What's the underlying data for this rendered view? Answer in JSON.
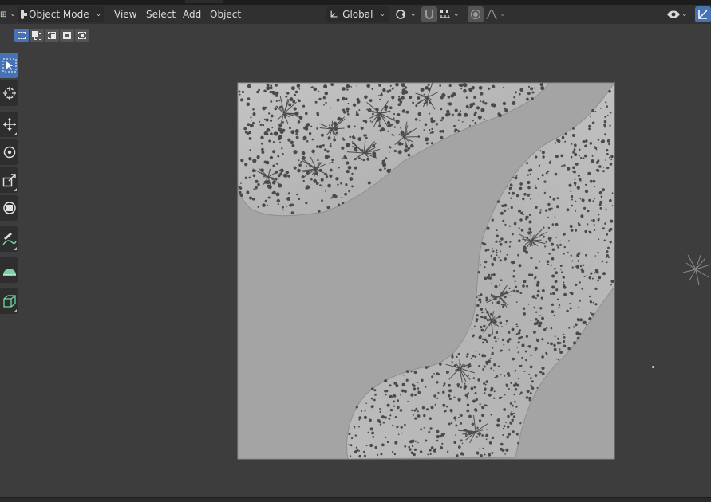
{
  "header": {
    "mode_label": "Object Mode",
    "menus": [
      "View",
      "Select",
      "Add",
      "Object"
    ],
    "transform_orientation": "Global"
  },
  "select_modes": [
    "select-new",
    "select-extend",
    "select-subtract",
    "select-invert",
    "select-intersect"
  ],
  "tools": [
    "select-box",
    "cursor",
    "move",
    "rotate",
    "scale",
    "transform",
    "annotate",
    "measure",
    "add-cube"
  ],
  "colors": {
    "viewport_bg": "#3d3d3d",
    "header_bg": "#303030",
    "accent": "#4772b3",
    "plane": "#a4a4a5",
    "terrain_strip": "#b6b6b7"
  }
}
